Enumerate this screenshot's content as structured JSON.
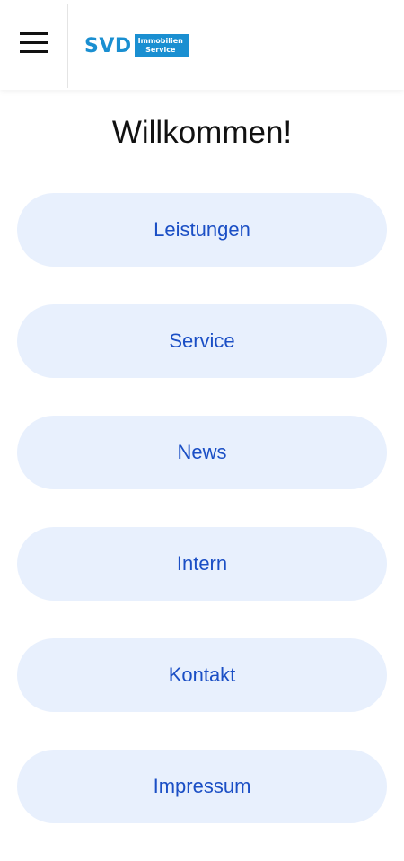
{
  "header": {
    "logo_text": "SVD",
    "logo_box_line1": "Immobilien",
    "logo_box_line2": "Service"
  },
  "main": {
    "title": "Willkommen!",
    "menu_items": [
      {
        "label": "Leistungen"
      },
      {
        "label": "Service"
      },
      {
        "label": "News"
      },
      {
        "label": "Intern"
      },
      {
        "label": "Kontakt"
      },
      {
        "label": "Impressum"
      }
    ]
  },
  "colors": {
    "brand_blue": "#1a8fd1",
    "button_bg": "#e8f0fd",
    "button_text": "#1b4fc5"
  },
  "icons": {
    "menu": "hamburger-menu-icon"
  }
}
